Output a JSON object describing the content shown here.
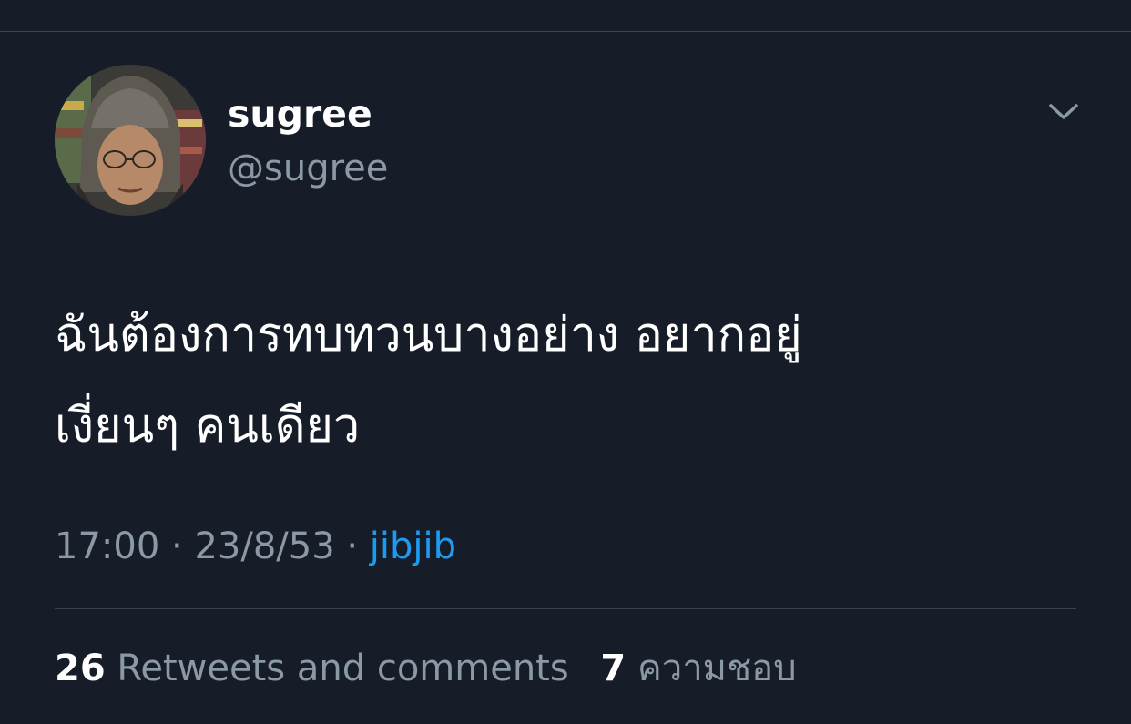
{
  "user": {
    "display_name": "sugree",
    "handle": "@sugree"
  },
  "tweet": {
    "text_lines": [
      "ฉันต้องการทบทวนบางอย่าง อยากอยู่",
      "เงี่ยนๆ คนเดียว"
    ],
    "time": "17:00",
    "date": "23/8/53",
    "separator": "·",
    "source": "jibjib"
  },
  "stats": {
    "retweets_count": "26",
    "retweets_label": "Retweets and comments",
    "likes_count": "7",
    "likes_label": "ความชอบ"
  },
  "icons": {
    "menu": "chevron-down-icon"
  },
  "colors": {
    "background": "#161d29",
    "primary_text": "#ffffff",
    "secondary_text": "#8b98a5",
    "link": "#1d9bf0"
  }
}
